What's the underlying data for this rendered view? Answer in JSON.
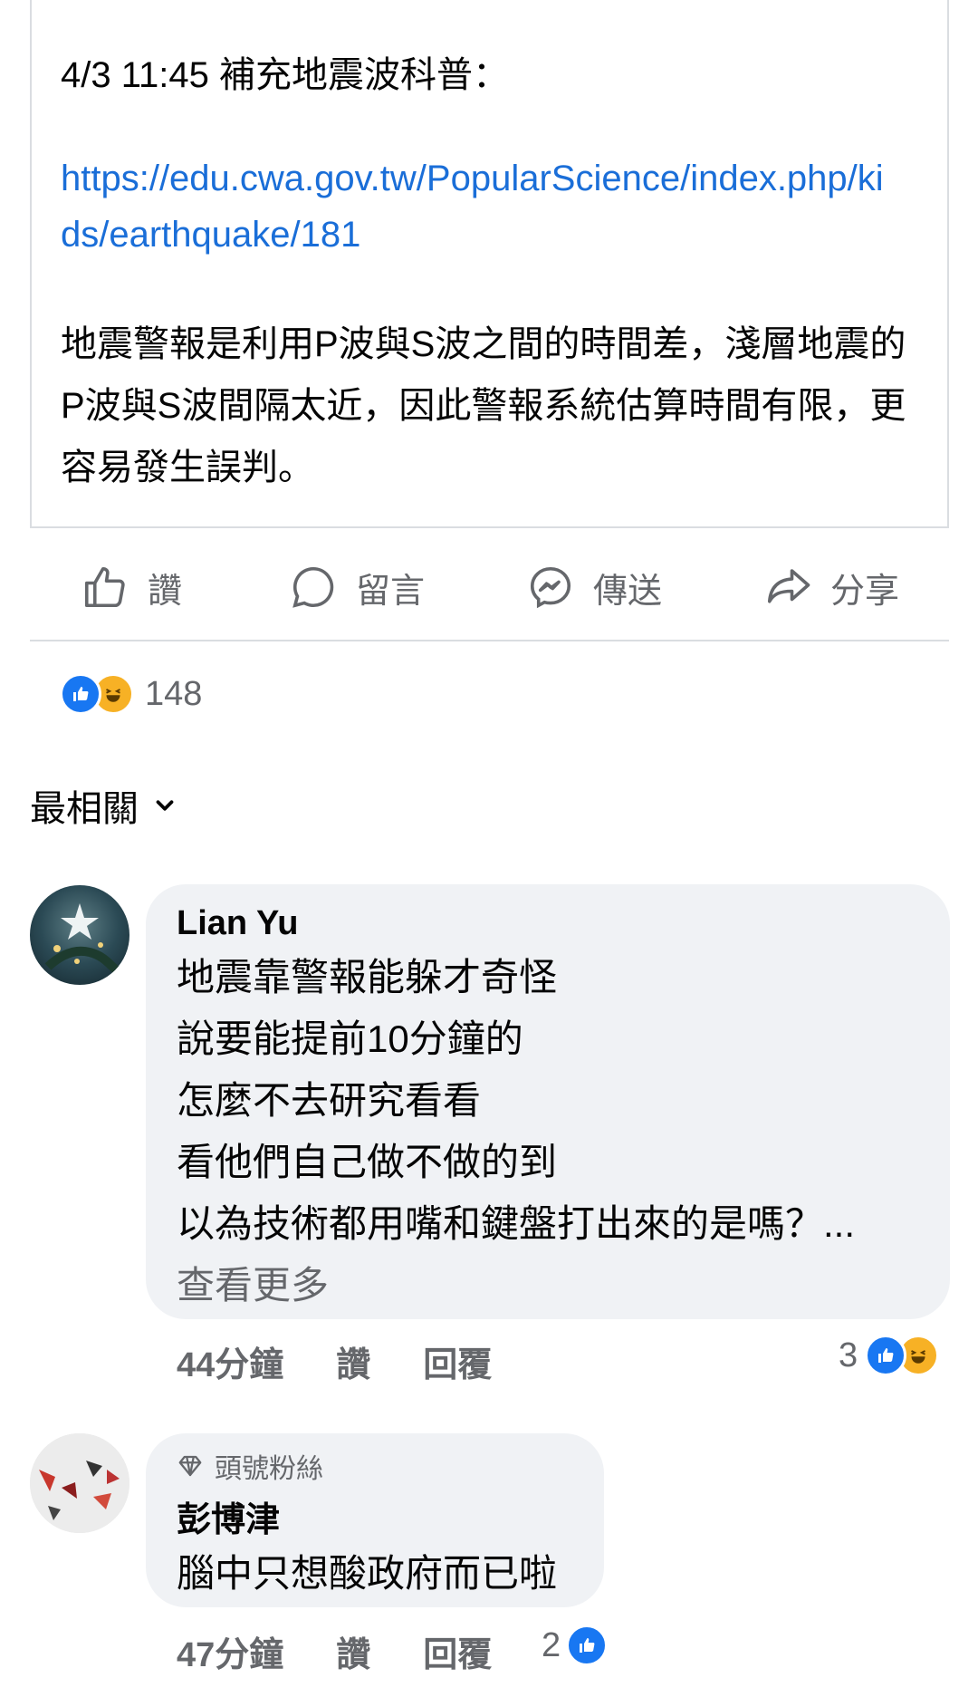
{
  "post": {
    "time_note": "4/3 11:45 補充地震波科普：",
    "link": "https://edu.cwa.gov.tw/PopularScience/index.php/kids/earthquake/181",
    "body": "地震警報是利用P波與S波之間的時間差，淺層地震的P波與S波間隔太近，因此警報系統估算時間有限，更容易發生誤判。"
  },
  "actions": {
    "like": "讚",
    "comment": "留言",
    "send": "傳送",
    "share": "分享"
  },
  "reactions": {
    "count": "148",
    "icons": [
      "like-icon",
      "haha-icon"
    ]
  },
  "sort": {
    "label": "最相關"
  },
  "comments": [
    {
      "author": "Lian Yu",
      "lines": [
        "地震靠警報能躲才奇怪",
        "說要能提前10分鐘的",
        "怎麼不去研究看看",
        "看他們自己做不做的到",
        "以為技術都用嘴和鍵盤打出來的是嗎？..."
      ],
      "see_more": "查看更多",
      "time": "44分鐘",
      "like": "讚",
      "reply": "回覆",
      "reaction_count": "3"
    },
    {
      "badge": "頭號粉絲",
      "author": "彭博津",
      "text": "腦中只想酸政府而已啦",
      "time": "47分鐘",
      "like": "讚",
      "reply": "回覆",
      "reaction_count": "2"
    }
  ],
  "colors": {
    "link": "#1a6ed8",
    "like_blue": "#1877f2",
    "haha_yellow": "#f7b125",
    "bubble_bg": "#f0f2f5",
    "secondary_text": "#65676b"
  }
}
